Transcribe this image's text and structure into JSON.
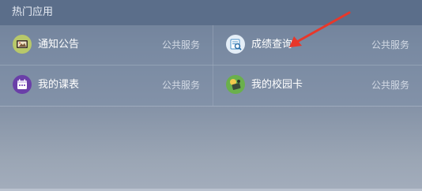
{
  "panel": {
    "title": "热门应用"
  },
  "apps": [
    {
      "label": "通知公告",
      "category": "公共服务",
      "icon": "notice-board-icon"
    },
    {
      "label": "成绩查询",
      "category": "公共服务",
      "icon": "grade-search-icon"
    },
    {
      "label": "我的课表",
      "category": "公共服务",
      "icon": "calendar-icon"
    },
    {
      "label": "我的校园卡",
      "category": "公共服务",
      "icon": "campus-card-icon"
    }
  ],
  "colors": {
    "header_bg": "#5b6e8a",
    "annotation_arrow": "#e8372a"
  }
}
